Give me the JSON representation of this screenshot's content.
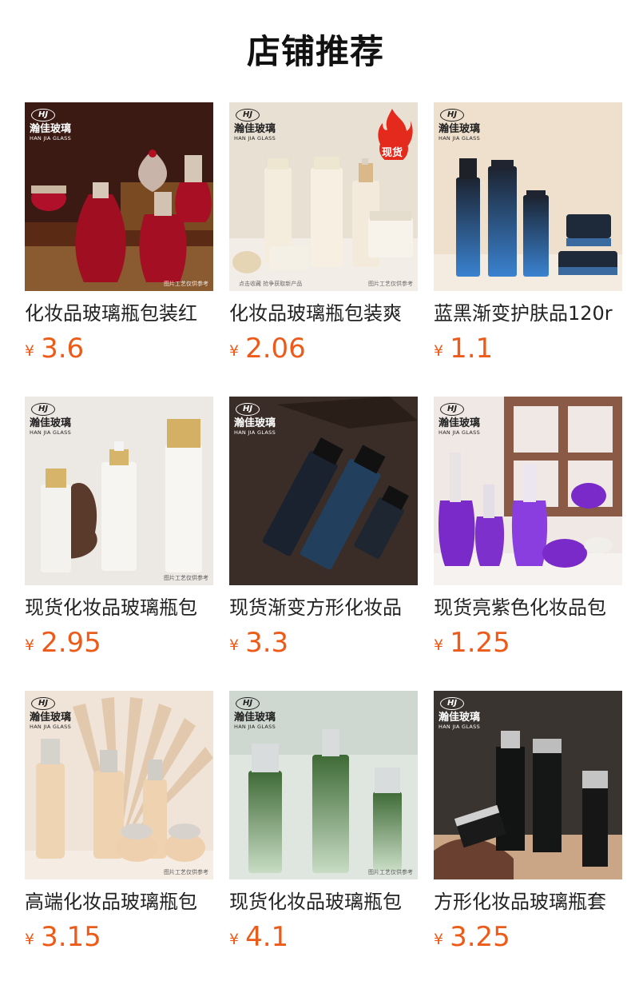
{
  "section": {
    "title": "店铺推荐"
  },
  "brand": {
    "logo": "HJ",
    "name_cn": "瀚佳玻璃",
    "name_en": "HAN JIA GLASS"
  },
  "image_notes": {
    "ref": "图片工艺仅供参考",
    "fav": "点击收藏 抢争获取新产品",
    "hot": "现货"
  },
  "currency": "¥",
  "colors": {
    "price": "#ec5b1a",
    "title": "#222222",
    "hot_badge": "#e42a1d"
  },
  "products": [
    {
      "name": "化妆品玻璃瓶包装红",
      "price": "3.6"
    },
    {
      "name": "化妆品玻璃瓶包装爽",
      "price": "2.06"
    },
    {
      "name": "蓝黑渐变护肤品120r",
      "price": "1.1"
    },
    {
      "name": "现货化妆品玻璃瓶包",
      "price": "2.95"
    },
    {
      "name": "现货渐变方形化妆品",
      "price": "3.3"
    },
    {
      "name": "现货亮紫色化妆品包",
      "price": "1.25"
    },
    {
      "name": "高端化妆品玻璃瓶包",
      "price": "3.15"
    },
    {
      "name": "现货化妆品玻璃瓶包",
      "price": "4.1"
    },
    {
      "name": "方形化妆品玻璃瓶套",
      "price": "3.25"
    }
  ]
}
